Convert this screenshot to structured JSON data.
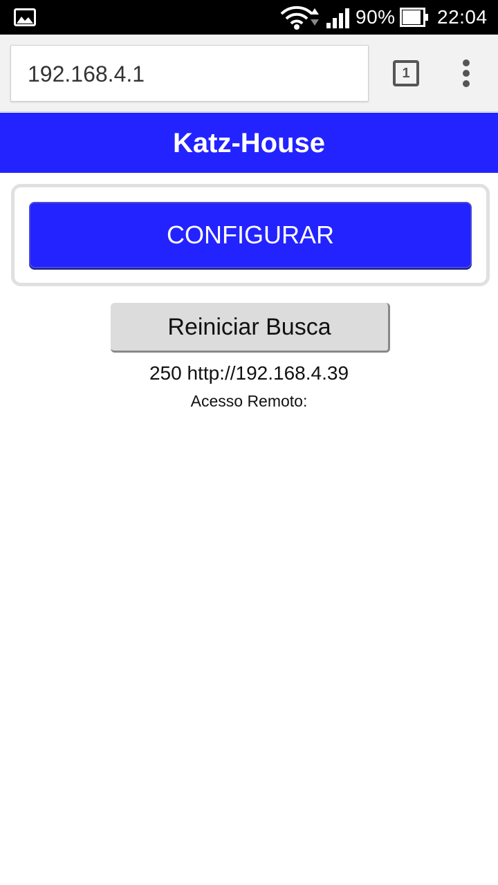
{
  "status_bar": {
    "battery_percent": "90%",
    "time": "22:04",
    "icons": [
      "gallery-icon",
      "wifi-icon",
      "data-arrows-icon",
      "signal-icon",
      "battery-icon"
    ]
  },
  "browser": {
    "url": "192.168.4.1",
    "tab_count": "1",
    "menu_icon": "more-vert-icon"
  },
  "page": {
    "title": "Katz-House",
    "configure_label": "CONFIGURAR",
    "restart_label": "Reiniciar Busca",
    "device_info": "250 http://192.168.4.39",
    "remote_access_label": "Acesso Remoto:"
  },
  "colors": {
    "header_bg": "#2323ff",
    "button_bg": "#2323ff",
    "secondary_button_bg": "#dcdcdc"
  }
}
